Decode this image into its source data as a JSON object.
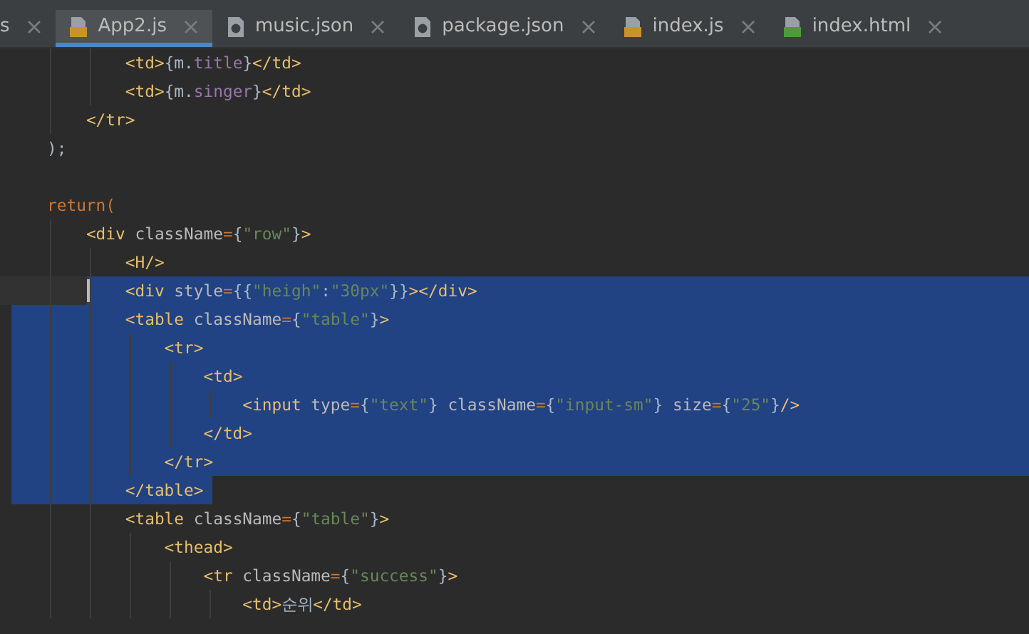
{
  "tabs": [
    {
      "label": "s",
      "kind": "cut",
      "selected": false
    },
    {
      "label": "App2.js",
      "kind": "js",
      "selected": true
    },
    {
      "label": "music.json",
      "kind": "json",
      "selected": false
    },
    {
      "label": "package.json",
      "kind": "json",
      "selected": false
    },
    {
      "label": "index.js",
      "kind": "js",
      "selected": false
    },
    {
      "label": "index.html",
      "kind": "html",
      "selected": false
    }
  ],
  "lines": [
    {
      "text": "        <td>{m.title}</td>",
      "selected": false
    },
    {
      "text": "        <td>{m.singer}</td>",
      "selected": false
    },
    {
      "text": "    </tr>",
      "selected": false
    },
    {
      "text": ");",
      "selected": false
    },
    {
      "selected": false
    },
    {
      "text": "return(",
      "selected": false
    },
    {
      "text": "    <div className={\"row\"}>",
      "selected": false
    },
    {
      "text": "        <H/>",
      "selected": false
    },
    {
      "text": "        <div style={{\"heigh\":\"30px\"}}></div>",
      "selected": true
    },
    {
      "text": "        <table className={\"table\"}>",
      "selected": true
    },
    {
      "text": "            <tr>",
      "selected": true
    },
    {
      "text": "                <td>",
      "selected": true
    },
    {
      "text": "                    <input type={\"text\"} className={\"input-sm\"} size={\"25\"}/>",
      "selected": true
    },
    {
      "text": "                </td>",
      "selected": true
    },
    {
      "text": "            </tr>",
      "selected": true
    },
    {
      "text": "        </table>",
      "selected": true
    },
    {
      "text": "        <table className={\"table\"}>",
      "selected": false
    },
    {
      "text": "            <thead>",
      "selected": false
    },
    {
      "text": "                <tr className={\"success\"}>",
      "selected": false
    },
    {
      "text": "                    <td>순위</td>",
      "selected": false
    }
  ]
}
